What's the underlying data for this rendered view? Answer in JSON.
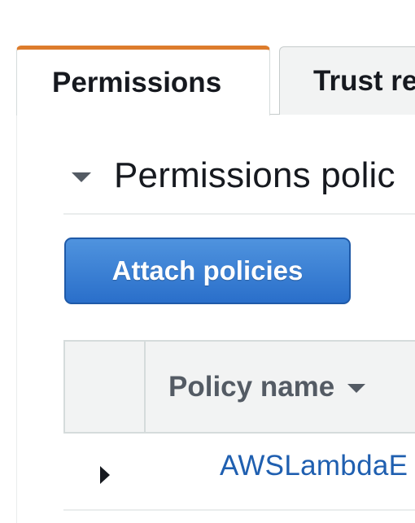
{
  "tabs": [
    {
      "label": "Permissions",
      "active": true
    },
    {
      "label": "Trust re",
      "active": false
    }
  ],
  "permissions_section": {
    "title": "Permissions polic",
    "attach_button_label": "Attach policies"
  },
  "table": {
    "columns": [
      {
        "label": ""
      },
      {
        "label": "Policy name"
      }
    ],
    "rows": [
      {
        "policy_name": "AWSLambdaE"
      }
    ]
  },
  "colors": {
    "active_tab_accent": "#dd7c2c",
    "primary_button": "#2a6fca",
    "link": "#1f5fb0",
    "text": "#16191f",
    "muted_text": "#545b64"
  },
  "icons": {
    "section_toggle": "caret-down-icon",
    "sort": "sort-caret-down-icon",
    "row_expand": "caret-right-icon"
  }
}
